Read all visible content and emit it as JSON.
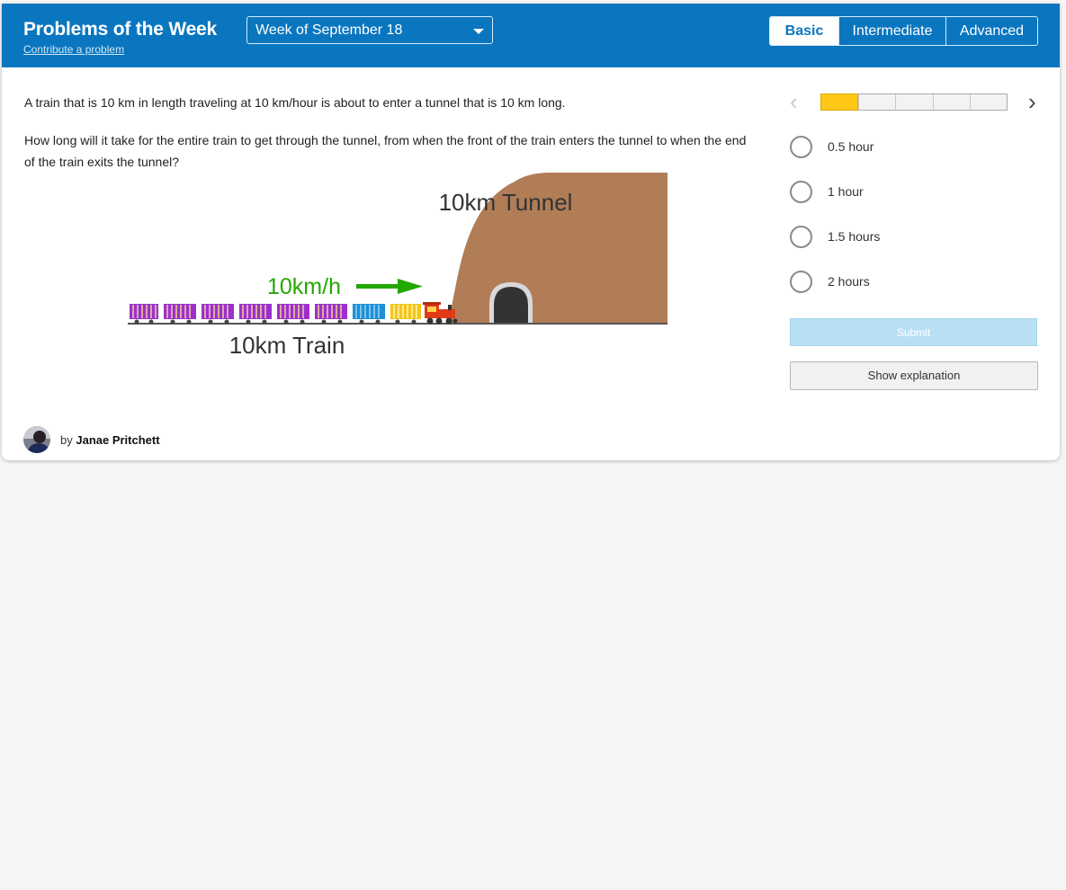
{
  "header": {
    "title": "Problems of the Week",
    "contribute_link": "Contribute a problem",
    "week_selected": "Week of September 18",
    "levels": [
      {
        "label": "Basic",
        "active": true
      },
      {
        "label": "Intermediate",
        "active": false
      },
      {
        "label": "Advanced",
        "active": false
      }
    ]
  },
  "question": {
    "statement": "A train that is 10 km in length traveling at 10 km/hour is about to enter a tunnel that is 10 km long.",
    "prompt": "How long will it take for the entire train to get through the tunnel, from when the front of the train enters the tunnel to when the end of the train exits the tunnel?",
    "illustration": {
      "tunnel_label": "10km Tunnel",
      "speed_label": "10km/h",
      "train_label": "10km Train"
    }
  },
  "progress": {
    "current": 1,
    "total": 5,
    "prev_icon": "chevron-left-icon",
    "next_icon": "chevron-right-icon"
  },
  "answers": {
    "options": [
      "0.5 hour",
      "1 hour",
      "1.5 hours",
      "2 hours"
    ],
    "submit_label": "Submit",
    "explanation_label": "Show explanation"
  },
  "author": {
    "prefix": "by",
    "name": "Janae Pritchett"
  },
  "colors": {
    "brand_blue": "#0a76bf",
    "progress_yellow": "#ffc817",
    "tunnel_brown": "#b07d57",
    "arrow_green": "#23a800"
  }
}
